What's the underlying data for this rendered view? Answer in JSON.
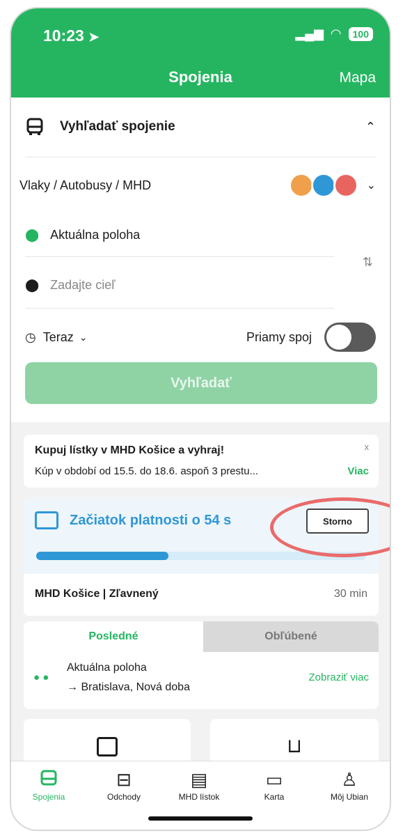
{
  "status_bar": {
    "time": "10:23",
    "battery": "100"
  },
  "header": {
    "title": "Spojenia",
    "right_link": "Mapa"
  },
  "search": {
    "section_title": "Vyhľadať spojenie",
    "transport_modes": "Vlaky / Autobusy / MHD",
    "from": "Aktuálna poloha",
    "to_placeholder": "Zadajte cieľ",
    "time_label": "Teraz",
    "direct_label": "Priamy spoj",
    "search_button": "Vyhľadať"
  },
  "promo": {
    "title": "Kupuj lístky v MHD Košice a vyhraj!",
    "text": "Kúp v období od 15.5. do 18.6. aspoň 3 prestu...",
    "link": "Viac",
    "close": "x"
  },
  "ticket": {
    "status": "Začiatok platnosti o 54 s",
    "cancel": "Storno",
    "progress": 0.4,
    "name": "MHD Košice | Zľavnený",
    "duration": "30 min"
  },
  "history": {
    "tabs": [
      "Posledné",
      "Obľúbené"
    ],
    "item_from": "Aktuálna poloha",
    "item_to": "→ Bratislava, Nová doba",
    "more": "Zobraziť viac"
  },
  "nav": [
    {
      "label": "Spojenia",
      "icon": "bus-icon"
    },
    {
      "label": "Odchody",
      "icon": "departures-icon"
    },
    {
      "label": "MHD lístok",
      "icon": "ticket-icon"
    },
    {
      "label": "Karta",
      "icon": "card-icon"
    },
    {
      "label": "Môj Ubian",
      "icon": "user-icon"
    }
  ],
  "colors": {
    "brand": "#25b561",
    "train": "#f0a04b",
    "bus": "#2f97d6",
    "tram": "#e8655f",
    "highlight": "#ea6b6b"
  }
}
